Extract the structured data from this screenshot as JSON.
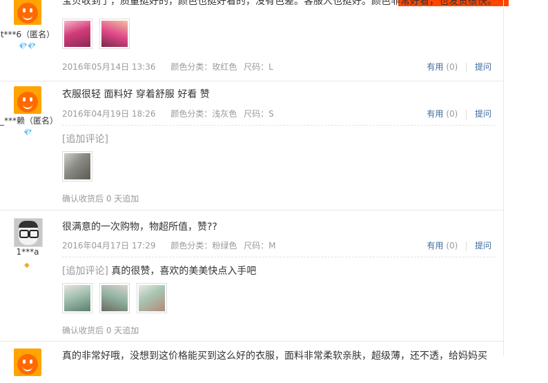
{
  "reviews": [
    {
      "nick": "t***6（匿名）",
      "avatar": "orange-taobao-avatar",
      "badge": "💎💎",
      "content": "宝贝收到了，质量挺好的，颜色也挺好看的，没有色差。客服人也挺好。颜色非常好看，也发货很快。",
      "date": "2016年05月14日 13:36",
      "sku_color": "颜色分类：玫红色",
      "sku_size": "尺码：L",
      "useful_label": "有用",
      "useful_count": "(0)",
      "ask_label": "提问",
      "photos": [
        "pink",
        "pink2"
      ]
    },
    {
      "nick": "_***赖（匿名）",
      "avatar": "orange-taobao-avatar",
      "badge": "💎",
      "content": "衣服很轻 面料好 穿着舒服 好看 赞",
      "date": "2016年04月19日 18:26",
      "sku_color": "颜色分类：浅灰色",
      "sku_size": "尺码：S",
      "useful_label": "有用",
      "useful_count": "(0)",
      "ask_label": "提问",
      "append_tag": "[追加评论]",
      "append_text": "",
      "photos": [
        "gray1"
      ],
      "confirm": "确认收货后 0 天追加"
    },
    {
      "nick": "1***a",
      "avatar": "glasses-avatar",
      "badge": "◆",
      "content": "很满意的一次购物，物超所值，赞??",
      "date": "2016年04月17日 17:29",
      "sku_color": "颜色分类：粉绿色",
      "sku_size": "尺码：M",
      "useful_label": "有用",
      "useful_count": "(0)",
      "ask_label": "提问",
      "append_tag": "[追加评论]",
      "append_text": "真的很赞，喜欢的美美快点入手吧",
      "photos": [
        "green1",
        "green2",
        "green3"
      ],
      "confirm": "确认收货后 0 天追加"
    },
    {
      "avatar": "orange-taobao-avatar",
      "content": "真的非常好哦，没想到这价格能买到这么好的衣服，面料非常柔软亲肤，超级薄，还不透，给妈妈买"
    }
  ]
}
